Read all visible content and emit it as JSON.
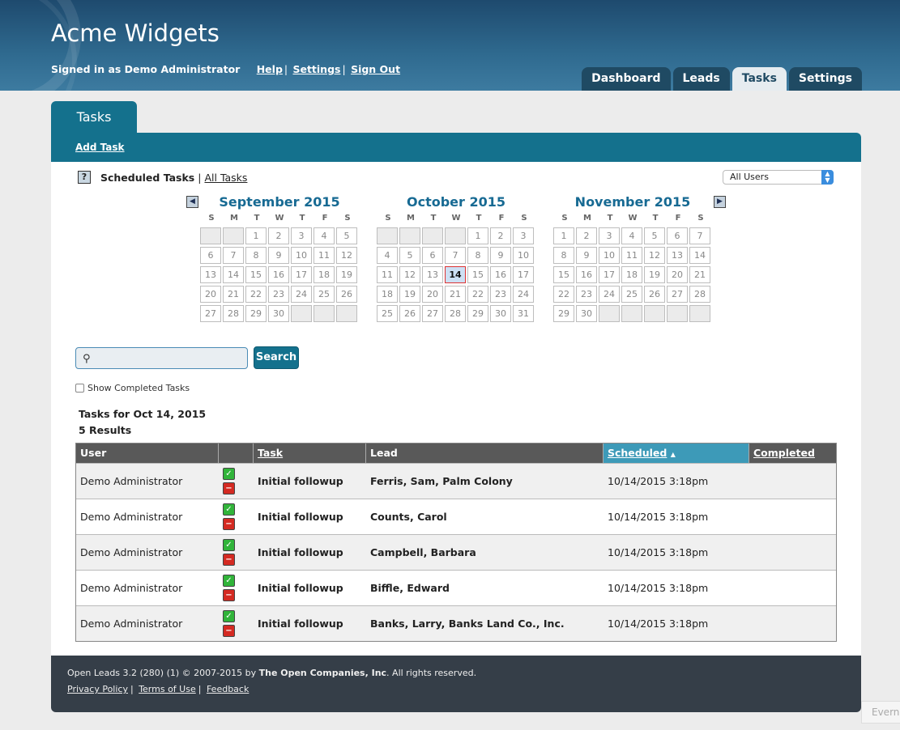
{
  "header": {
    "title": "Acme Widgets",
    "signed_in": "Signed in as Demo Administrator",
    "links": [
      "Help",
      "Settings",
      "Sign Out"
    ]
  },
  "main_tabs": [
    "Dashboard",
    "Leads",
    "Tasks",
    "Settings"
  ],
  "active_main_tab": "Tasks",
  "section_tab": "Tasks",
  "actions": {
    "add_task": "Add Task"
  },
  "filter": {
    "help_glyph": "?",
    "scheduled": "Scheduled Tasks",
    "all": "All Tasks",
    "user_select": "All Users"
  },
  "calendar": {
    "weekday_labels": [
      "S",
      "M",
      "T",
      "W",
      "T",
      "F",
      "S"
    ],
    "months": [
      {
        "title": "September 2015",
        "first_weekday": 2,
        "days": 30
      },
      {
        "title": "October 2015",
        "first_weekday": 4,
        "days": 31,
        "today": 14
      },
      {
        "title": "November 2015",
        "first_weekday": 0,
        "days": 30
      }
    ]
  },
  "search": {
    "button": "Search",
    "value": ""
  },
  "show_completed_label": "Show Completed Tasks",
  "results": {
    "heading": "Tasks for Oct 14, 2015",
    "count": "5 Results"
  },
  "table": {
    "headers": {
      "user": "User",
      "task": "Task",
      "lead": "Lead",
      "scheduled": "Scheduled",
      "sort_indicator": "▲",
      "completed": "Completed"
    },
    "rows": [
      {
        "user": "Demo Administrator",
        "task": "Initial followup",
        "lead": "Ferris, Sam, Palm Colony",
        "scheduled": "10/14/2015 3:18pm",
        "completed": ""
      },
      {
        "user": "Demo Administrator",
        "task": "Initial followup",
        "lead": "Counts, Carol",
        "scheduled": "10/14/2015 3:18pm",
        "completed": ""
      },
      {
        "user": "Demo Administrator",
        "task": "Initial followup",
        "lead": "Campbell, Barbara",
        "scheduled": "10/14/2015 3:18pm",
        "completed": ""
      },
      {
        "user": "Demo Administrator",
        "task": "Initial followup",
        "lead": "Biffle, Edward",
        "scheduled": "10/14/2015 3:18pm",
        "completed": ""
      },
      {
        "user": "Demo Administrator",
        "task": "Initial followup",
        "lead": "Banks, Larry, Banks Land Co., Inc.",
        "scheduled": "10/14/2015 3:18pm",
        "completed": ""
      }
    ]
  },
  "footer": {
    "copyright_prefix": "Open Leads 3.2 (280) (1) © 2007-2015 by ",
    "company": "The Open Companies, Inc",
    "copyright_suffix": ". All rights reserved.",
    "links": [
      "Privacy Policy",
      "Terms of Use",
      "Feedback"
    ]
  },
  "evernote_tab": "Evern"
}
